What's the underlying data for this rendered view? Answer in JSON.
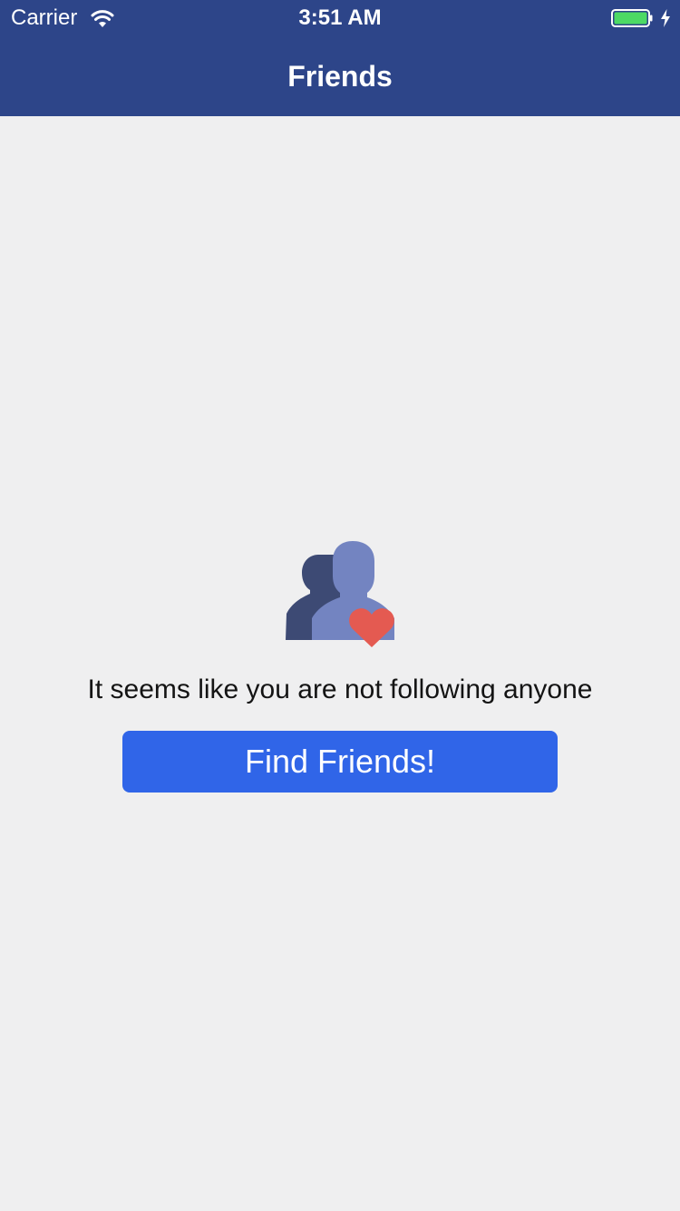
{
  "status_bar": {
    "carrier": "Carrier",
    "time": "3:51 AM",
    "icons": [
      "wifi-icon",
      "battery-icon",
      "charging-bolt-icon"
    ]
  },
  "nav": {
    "title": "Friends"
  },
  "empty_state": {
    "icon": "friends-heart-icon",
    "message": "It seems like you are not following anyone",
    "button_label": "Find Friends!"
  },
  "colors": {
    "header_bg": "#2d4589",
    "page_bg": "#efeff0",
    "button_bg": "#3065e8",
    "heart": "#e45a51",
    "person_back": "#3d4a74",
    "person_front": "#7384c1",
    "battery_fill": "#4cd964"
  }
}
